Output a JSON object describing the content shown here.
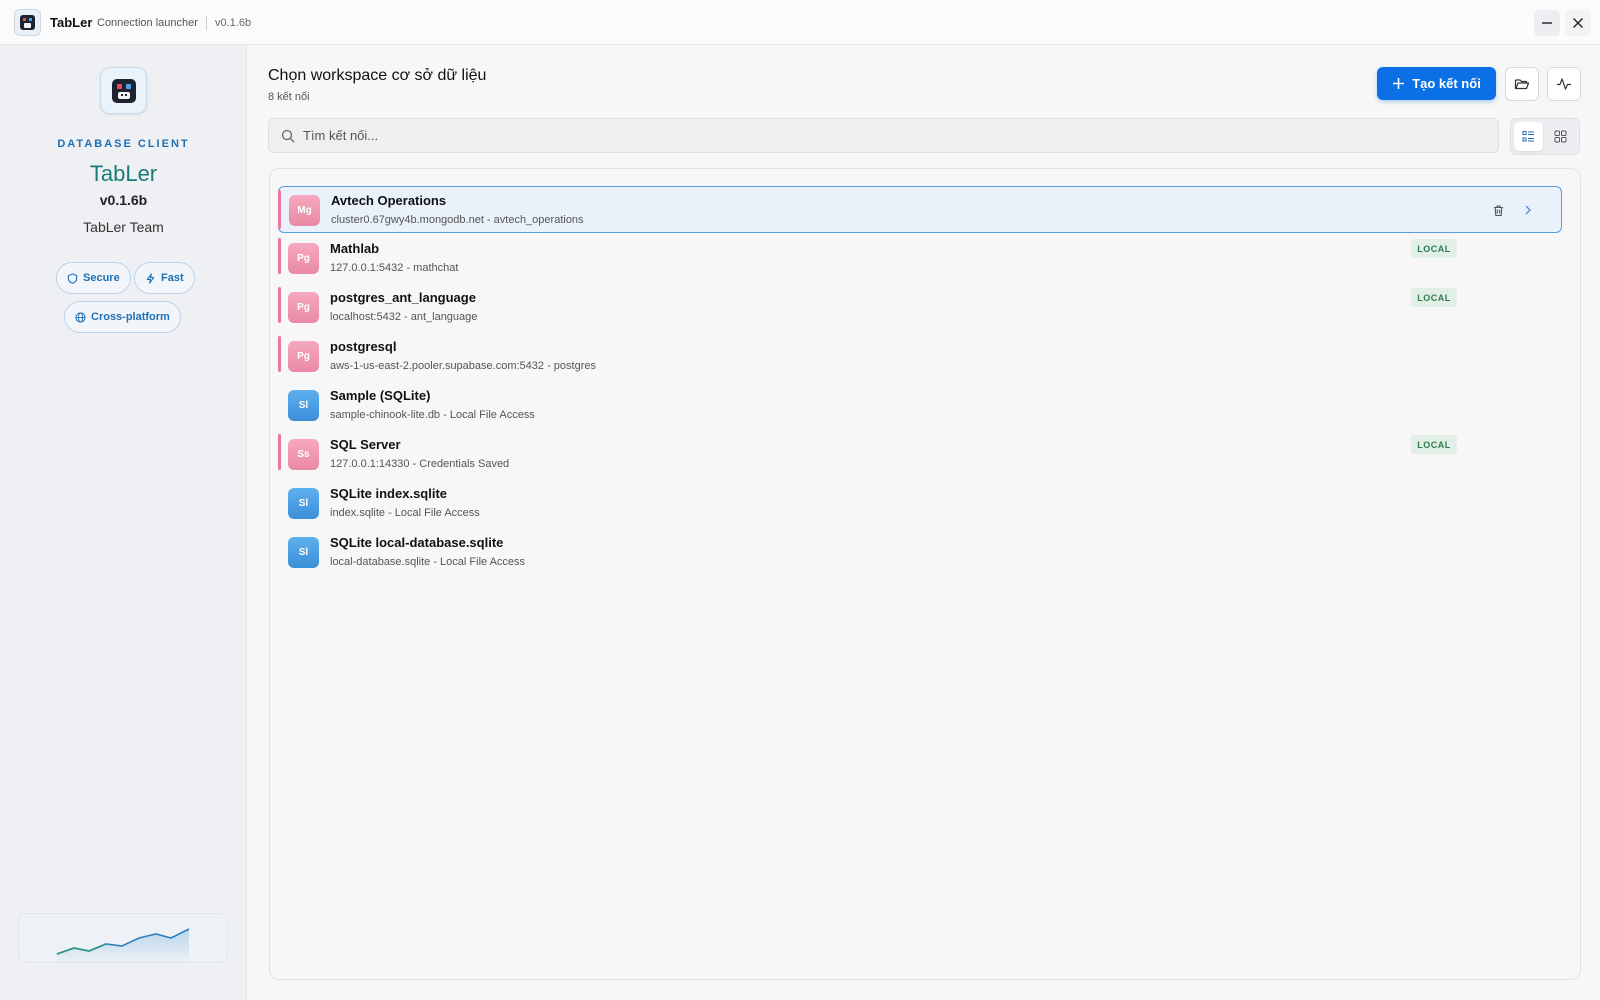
{
  "titlebar": {
    "app_name": "TabLer",
    "subtitle": "Connection launcher",
    "version": "v0.1.6b"
  },
  "sidebar": {
    "kicker": "DATABASE CLIENT",
    "name": "TabLer",
    "version": "v0.1.6b",
    "team": "TabLer Team",
    "chips": {
      "secure": "Secure",
      "fast": "Fast",
      "cross": "Cross-platform"
    }
  },
  "header": {
    "title": "Chọn workspace cơ sở dữ liệu",
    "count": "8 kết nối",
    "create_label": "Tạo kết nối"
  },
  "search": {
    "placeholder": "Tìm kết nối..."
  },
  "local_label": "LOCAL",
  "connections": [
    {
      "badge": "Mg",
      "name": "Avtech Operations",
      "sub": "cluster0.67gwy4b.mongodb.net - avtech_operations"
    },
    {
      "badge": "Pg",
      "name": "Mathlab",
      "sub": "127.0.0.1:5432 - mathchat"
    },
    {
      "badge": "Pg",
      "name": "postgres_ant_language",
      "sub": "localhost:5432 - ant_language"
    },
    {
      "badge": "Pg",
      "name": "postgresql",
      "sub": "aws-1-us-east-2.pooler.supabase.com:5432 - postgres"
    },
    {
      "badge": "Sl",
      "name": "Sample (SQLite)",
      "sub": "sample-chinook-lite.db - Local File Access"
    },
    {
      "badge": "Ss",
      "name": "SQL Server",
      "sub": "127.0.0.1:14330 - Credentials Saved"
    },
    {
      "badge": "Sl",
      "name": "SQLite index.sqlite",
      "sub": "index.sqlite - Local File Access"
    },
    {
      "badge": "Sl",
      "name": "SQLite local-database.sqlite",
      "sub": "local-database.sqlite - Local File Access"
    }
  ],
  "colors": {
    "primary": "#0b6fe6",
    "brand_teal": "#1a7a78",
    "badge_pink": "#ea8aa5",
    "badge_blue": "#3b8fd8",
    "local_green": "#2e7d4f"
  }
}
